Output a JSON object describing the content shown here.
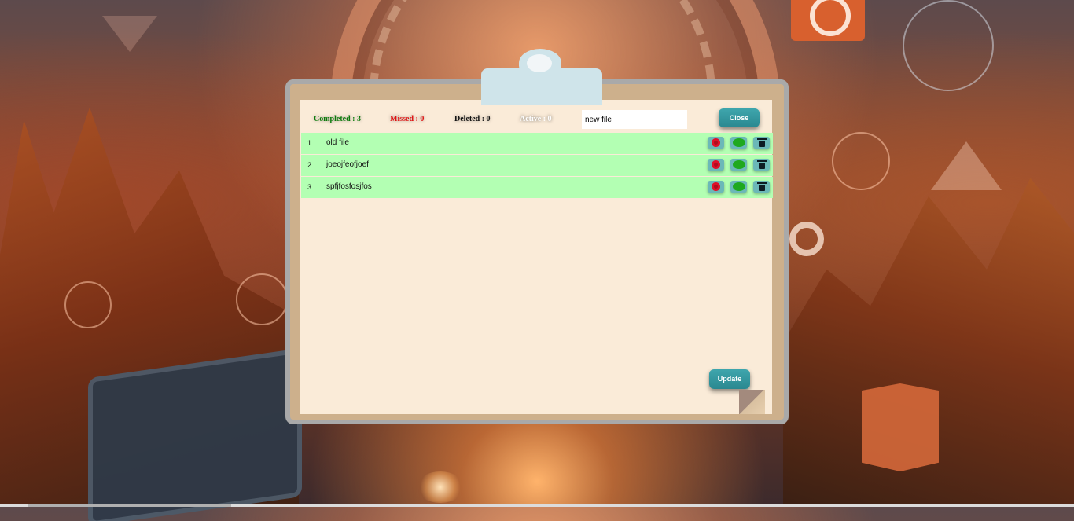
{
  "stats": {
    "completed": "Completed : 3",
    "missed": "Missed : 0",
    "deleted": "Deleted : 0",
    "active": "Active : 0"
  },
  "new_task": {
    "value": "new file"
  },
  "buttons": {
    "close": "Close",
    "update": "Update"
  },
  "tasks": [
    {
      "num": "1",
      "text": "old file"
    },
    {
      "num": "2",
      "text": "joeojfeofjoef"
    },
    {
      "num": "3",
      "text": "spfjfosfosjfos"
    }
  ],
  "colors": {
    "row_bg": "#b3ffb3",
    "button": "#2f979e",
    "paper": "#faebd8",
    "board": "#cdb08c"
  },
  "icons": [
    "x-circle-icon",
    "green-circle-icon",
    "trash-icon"
  ]
}
